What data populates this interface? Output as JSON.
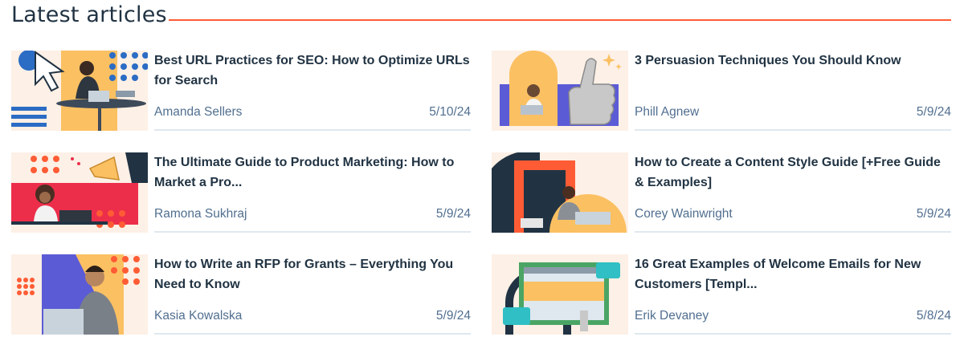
{
  "section": {
    "title": "Latest articles"
  },
  "colors": {
    "accent": "#ff5c35",
    "text": "#213343",
    "meta": "#516f90",
    "divider": "#dfe8ef"
  },
  "articles": [
    {
      "title": "Best URL Practices for SEO: How to Optimize URLs for Search",
      "author": "Amanda Sellers",
      "date": "5/10/24",
      "image": "woman-laptop-cursor-illustration"
    },
    {
      "title": "3 Persuasion Techniques You Should Know",
      "author": "Phill Agnew",
      "date": "5/9/24",
      "image": "thumbs-up-illustration"
    },
    {
      "title": "The Ultimate Guide to Product Marketing: How to Market a Pro...",
      "author": "Ramona Sukhraj",
      "date": "5/9/24",
      "image": "megaphone-illustration"
    },
    {
      "title": "How to Create a Content Style Guide [+Free Guide & Examples]",
      "author": "Corey Wainwright",
      "date": "5/9/24",
      "image": "man-laptop-arch-illustration"
    },
    {
      "title": "How to Write an RFP for Grants – Everything You Need to Know",
      "author": "Kasia Kowalska",
      "date": "5/9/24",
      "image": "man-laptop-dots-illustration"
    },
    {
      "title": "16 Great Examples of Welcome Emails for New Customers [Templ...",
      "author": "Erik Devaney",
      "date": "5/8/24",
      "image": "welcome-email-illustration"
    }
  ]
}
